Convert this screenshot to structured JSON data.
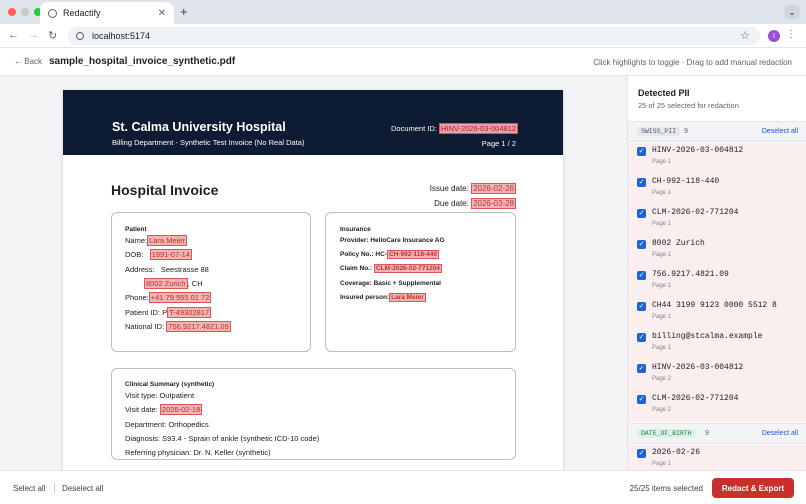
{
  "browser": {
    "tab_title": "Redactify",
    "url": "localhost:5174",
    "profile_initial": "I"
  },
  "header": {
    "back_label": "Back",
    "filename": "sample_hospital_invoice_synthetic.pdf",
    "hint": "Click highlights to toggle · Drag to add manual redaction"
  },
  "document": {
    "hospital": "St. Calma University Hospital",
    "subtitle": "Billing Department - Synthetic Test Invoice (No Real Data)",
    "doc_id_label": "Document ID:",
    "doc_id": "HINV-2026-03-004812",
    "page": "Page 1 / 2",
    "title": "Hospital Invoice",
    "issue_label": "Issue date:",
    "issue_date": "2026-02-26",
    "due_label": "Due date:",
    "due_date": "2026-03-28",
    "patient": {
      "heading": "Patient",
      "name_label": "Name:",
      "name": "Lara Meier",
      "dob_label": "DOB:",
      "dob": "1991-07-14",
      "address_label": "Address:",
      "street": "Seestrasse 88",
      "city": "8002 Zurich",
      "country": ", CH",
      "phone_label": "Phone:",
      "phone": "+41 79 555 01 72",
      "pid_label": "Patient ID: P",
      "pid": "T-49302817",
      "nid_label": "National ID:",
      "nid": "756.9217.4821.09"
    },
    "insurance": {
      "heading": "Insurance",
      "provider": "Provider: HelioCare Insurance AG",
      "policy_label": "Policy No.: HC-",
      "policy": "CH-992-118-440",
      "claim_label": "Claim No.:",
      "claim": "CLM-2026-02-771204",
      "coverage": "Coverage:   Basic + Supplemental",
      "insured_label": "Insured person:",
      "insured": "Lara Meier"
    },
    "clinical": {
      "heading": "Clinical Summary (synthetic)",
      "visit_type": "Visit type: Outpatient",
      "visit_label": "Visit date:",
      "visit_date": "2026-02-18",
      "department": "Department: Orthopedics",
      "diagnosis": "Diagnosis:  S93.4 - Sprain of ankle (synthetic ICD-10 code)",
      "referring": "Referring physician: Dr. N. Keller (synthetic)"
    }
  },
  "sidebar": {
    "title": "Detected PII",
    "summary": "25 of 25 selected for redaction",
    "groups": [
      {
        "tag": "SWISS_PII",
        "count": "9",
        "action": "Deselect all",
        "color": "#4a5563",
        "bg": "#e6e8eb"
      },
      {
        "tag": "DATE_OF_BIRTH",
        "count": "9",
        "action": "Deselect all",
        "color": "#1e7b4a",
        "bg": "#dcf3e6"
      }
    ],
    "items": [
      {
        "value": "HINV-2026-03-004812",
        "page": "Page 1"
      },
      {
        "value": "CH-992-118-440",
        "page": "Page 1"
      },
      {
        "value": "CLM-2026-02-771204",
        "page": "Page 1"
      },
      {
        "value": "8002 Zurich",
        "page": "Page 1"
      },
      {
        "value": "756.9217.4821.09",
        "page": "Page 1"
      },
      {
        "value": "CH44 3199 9123 0000 5512 8",
        "page": "Page 1"
      },
      {
        "value": "billing@stcalma.example",
        "page": "Page 1"
      },
      {
        "value": "HINV-2026-03-004812",
        "page": "Page 2"
      },
      {
        "value": "CLM-2026-02-771204",
        "page": "Page 2"
      },
      {
        "value": "2026-02-26",
        "page": "Page 1"
      }
    ]
  },
  "footer": {
    "select_all": "Select all",
    "deselect_all": "Deselect all",
    "count": "25/25 items selected",
    "redact": "Redact & Export"
  }
}
